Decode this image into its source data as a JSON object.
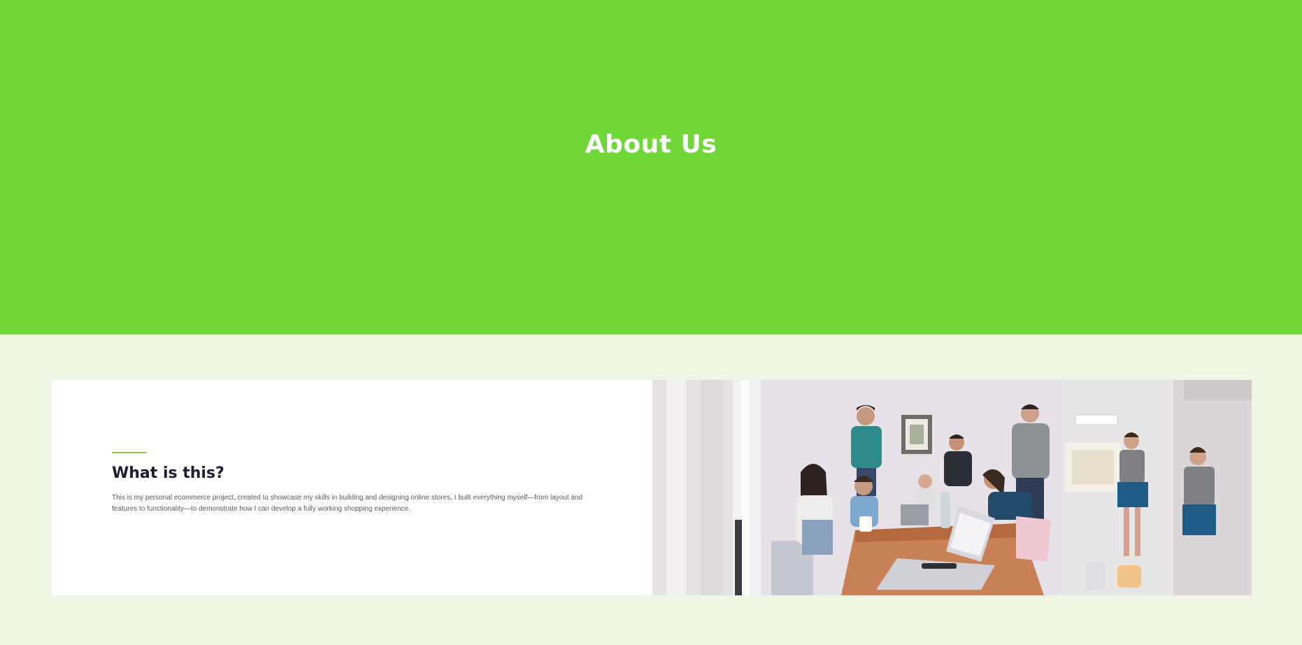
{
  "hero": {
    "title": "About Us"
  },
  "about": {
    "heading": "What is this?",
    "body": "This is my personal ecommerce project, created to showcase my skills in building and designing online stores. I built everything myself—from layout and features to functionality—to demonstrate how I can develop a fully working shopping experience."
  },
  "colors": {
    "hero_bg": "#6fd738",
    "band_bg": "#eef8e4",
    "heading": "#1d1d35",
    "accent": "#6fd738"
  },
  "photo": {
    "icon": "team-photo"
  }
}
